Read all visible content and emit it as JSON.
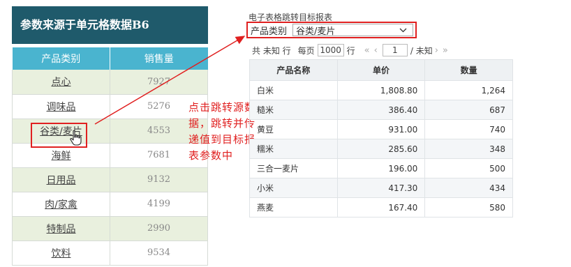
{
  "source": {
    "title": "参数来源于单元格数据B6",
    "headers": [
      "产品类别",
      "销售量"
    ],
    "rows": [
      {
        "category": "点心",
        "value": "7927"
      },
      {
        "category": "调味品",
        "value": "5276"
      },
      {
        "category": "谷类/麦片",
        "value": "4553"
      },
      {
        "category": "海鲜",
        "value": "7681"
      },
      {
        "category": "日用品",
        "value": "9132"
      },
      {
        "category": "肉/家禽",
        "value": "4199"
      },
      {
        "category": "特制品",
        "value": "2990"
      },
      {
        "category": "饮料",
        "value": "9534"
      }
    ]
  },
  "annotation": {
    "text": "点击跳转源数据，跳转并传递值到目标报表参数中",
    "color": "#e02020"
  },
  "target": {
    "label": "电子表格跳转目标报表",
    "param_label": "产品类别",
    "param_value": "谷类/麦片",
    "pager": {
      "total_text": "共 未知 行",
      "per_page_label": "每页",
      "per_page_value": "1000",
      "row_unit": "行",
      "page_value": "1",
      "page_total": "/ 未知"
    },
    "headers": [
      "产品名称",
      "单价",
      "数量"
    ],
    "rows": [
      {
        "name": "白米",
        "price": "1,808.80",
        "qty": "1,264"
      },
      {
        "name": "糙米",
        "price": "386.40",
        "qty": "687"
      },
      {
        "name": "黄豆",
        "price": "931.00",
        "qty": "740"
      },
      {
        "name": "糯米",
        "price": "285.60",
        "qty": "348"
      },
      {
        "name": "三合一麦片",
        "price": "196.00",
        "qty": "500"
      },
      {
        "name": "小米",
        "price": "417.30",
        "qty": "434"
      },
      {
        "name": "燕麦",
        "price": "167.40",
        "qty": "580"
      }
    ]
  },
  "colors": {
    "source_title_bg": "#1f5a6b",
    "source_header_bg": "#4ab4cf",
    "source_row_alt": "#e9f0de",
    "highlight": "#e02020"
  }
}
